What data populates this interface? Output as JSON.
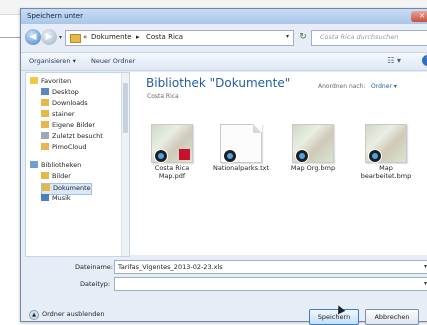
{
  "window": {
    "title": "Speichern unter"
  },
  "address": {
    "crumbs": [
      "«",
      "Dokumente",
      "▸",
      "Costa Rica"
    ],
    "search_placeholder": "Costa Rica durchsuchen"
  },
  "toolbar": {
    "organize": "Organisieren ▾",
    "new_folder": "Neuer Ordner"
  },
  "nav": {
    "items": [
      {
        "label": "Favoriten",
        "icon": "star-icon",
        "type": "group"
      },
      {
        "label": "Desktop",
        "icon": "desktop-icon",
        "type": "sub"
      },
      {
        "label": "Downloads",
        "icon": "folder-icon",
        "type": "sub"
      },
      {
        "label": "stainer",
        "icon": "folder-icon",
        "type": "sub"
      },
      {
        "label": "Eigene Bilder",
        "icon": "folder-icon",
        "type": "sub"
      },
      {
        "label": "Zuletzt besucht",
        "icon": "recent-icon",
        "type": "sub"
      },
      {
        "label": "PimoCloud",
        "icon": "folder-icon",
        "type": "sub"
      },
      {
        "label": "Bibliotheken",
        "icon": "library-icon",
        "type": "group"
      },
      {
        "label": "Bilder",
        "icon": "folder-icon",
        "type": "sub"
      },
      {
        "label": "Dokumente",
        "icon": "folder-icon",
        "type": "sub",
        "selected": true
      },
      {
        "label": "Musik",
        "icon": "music-icon",
        "type": "sub"
      }
    ]
  },
  "content": {
    "library_title": "Bibliothek \"Dokumente\"",
    "library_subtitle": "Costa Rica",
    "arrange_label": "Anordnen nach:",
    "arrange_value": "Ordner ▾",
    "files": [
      {
        "name": "Costa Rica Map.pdf",
        "thumb": "map",
        "pdf": true
      },
      {
        "name": "Nationalparks.txt",
        "thumb": "doc",
        "pdf": false
      },
      {
        "name": "Map Org.bmp",
        "thumb": "map",
        "pdf": false
      },
      {
        "name": "Map bearbeitet.bmp",
        "thumb": "map",
        "pdf": false
      }
    ]
  },
  "form": {
    "filename_label": "Dateiname:",
    "filename_value": "Tarifas_Vigentes_2013-02-23.xls",
    "filetype_label": "Dateityp:",
    "filetype_value": ""
  },
  "footer": {
    "hide_folders": "Ordner ausblenden",
    "save": "Speichern",
    "cancel": "Abbrechen"
  },
  "colors": {
    "accent": "#1f5fa8",
    "background": "#e6edf6"
  }
}
